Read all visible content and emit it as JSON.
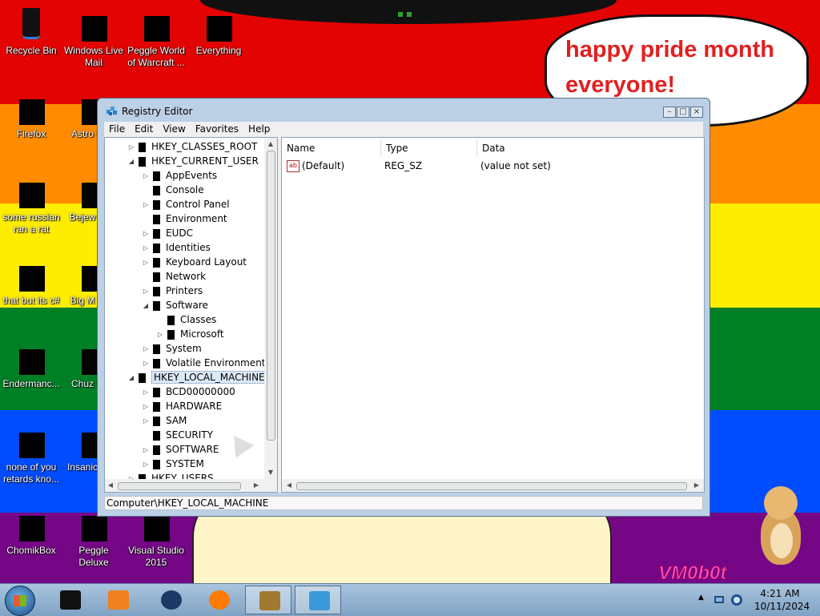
{
  "wallpaper": {
    "speech_text": "happy pride month everyone!",
    "signature": "VM0b0t",
    "colors": [
      "#e40303",
      "#ff8c00",
      "#ffed00",
      "#008026",
      "#004dff",
      "#750787"
    ]
  },
  "desktop_icons": [
    {
      "label": "Recycle Bin",
      "icon": "recycle-bin-icon"
    },
    {
      "label": "Windows Live Mail",
      "icon": "windows-live-mail-icon"
    },
    {
      "label": "Peggle World of Warcraft ...",
      "icon": "peggle-wow-icon"
    },
    {
      "label": "Everything",
      "icon": "everything-search-icon"
    },
    {
      "label": "Firefox",
      "icon": "firefox-icon"
    },
    {
      "label": "Astro Delu",
      "icon": "astro-icon"
    },
    {
      "label": "some russian ran a rat",
      "icon": "app-icon"
    },
    {
      "label": "Bejew Delu",
      "icon": "bejeweled-icon"
    },
    {
      "label": "that but its c#",
      "icon": "app-icon"
    },
    {
      "label": "Big M Delu",
      "icon": "app-icon"
    },
    {
      "label": "Endermanc...",
      "icon": "app-icon"
    },
    {
      "label": "Chuz Delu",
      "icon": "app-icon"
    },
    {
      "label": "none of you retards kno...",
      "icon": "app-icon"
    },
    {
      "label": "Insanic Delu",
      "icon": "app-icon"
    },
    {
      "label": "ChomikBox",
      "icon": "chomikbox-icon"
    },
    {
      "label": "Peggle Deluxe",
      "icon": "peggle-icon"
    },
    {
      "label": "Visual Studio 2015",
      "icon": "visual-studio-icon"
    }
  ],
  "regedit": {
    "title": "Registry Editor",
    "menu": [
      "File",
      "Edit",
      "View",
      "Favorites",
      "Help"
    ],
    "tree": [
      {
        "label": "HKEY_CLASSES_ROOT",
        "level": 0,
        "exp": "▷"
      },
      {
        "label": "HKEY_CURRENT_USER",
        "level": 0,
        "exp": "◢"
      },
      {
        "label": "AppEvents",
        "level": 1,
        "exp": "▷"
      },
      {
        "label": "Console",
        "level": 1,
        "exp": ""
      },
      {
        "label": "Control Panel",
        "level": 1,
        "exp": "▷"
      },
      {
        "label": "Environment",
        "level": 1,
        "exp": ""
      },
      {
        "label": "EUDC",
        "level": 1,
        "exp": "▷"
      },
      {
        "label": "Identities",
        "level": 1,
        "exp": "▷"
      },
      {
        "label": "Keyboard Layout",
        "level": 1,
        "exp": "▷"
      },
      {
        "label": "Network",
        "level": 1,
        "exp": ""
      },
      {
        "label": "Printers",
        "level": 1,
        "exp": "▷"
      },
      {
        "label": "Software",
        "level": 1,
        "exp": "◢"
      },
      {
        "label": "Classes",
        "level": 2,
        "exp": ""
      },
      {
        "label": "Microsoft",
        "level": 2,
        "exp": "▷"
      },
      {
        "label": "System",
        "level": 1,
        "exp": "▷"
      },
      {
        "label": "Volatile Environment",
        "level": 1,
        "exp": "▷"
      },
      {
        "label": "HKEY_LOCAL_MACHINE",
        "level": 0,
        "exp": "◢",
        "selected": true
      },
      {
        "label": "BCD00000000",
        "level": 1,
        "exp": "▷"
      },
      {
        "label": "HARDWARE",
        "level": 1,
        "exp": "▷"
      },
      {
        "label": "SAM",
        "level": 1,
        "exp": "▷"
      },
      {
        "label": "SECURITY",
        "level": 1,
        "exp": ""
      },
      {
        "label": "SOFTWARE",
        "level": 1,
        "exp": "▷"
      },
      {
        "label": "SYSTEM",
        "level": 1,
        "exp": "▷"
      },
      {
        "label": "HKEY_USERS",
        "level": 0,
        "exp": "▷"
      }
    ],
    "columns": {
      "name": "Name",
      "type": "Type",
      "data": "Data"
    },
    "values": [
      {
        "icon": "ab",
        "name": "(Default)",
        "type": "REG_SZ",
        "data": "(value not set)"
      }
    ],
    "status_path": "Computer\\HKEY_LOCAL_MACHINE",
    "window_buttons": {
      "min": "–",
      "max": "□",
      "close": "×"
    }
  },
  "taskbar": {
    "apps": [
      {
        "name": "black-app-icon",
        "active": false
      },
      {
        "name": "media-player-icon",
        "active": false
      },
      {
        "name": "globe-icon",
        "active": false
      },
      {
        "name": "firefox-icon",
        "active": false
      },
      {
        "name": "chomikbox-icon",
        "active": true
      },
      {
        "name": "regedit-icon",
        "active": true
      }
    ],
    "time": "4:21 AM",
    "date": "10/11/2024"
  }
}
